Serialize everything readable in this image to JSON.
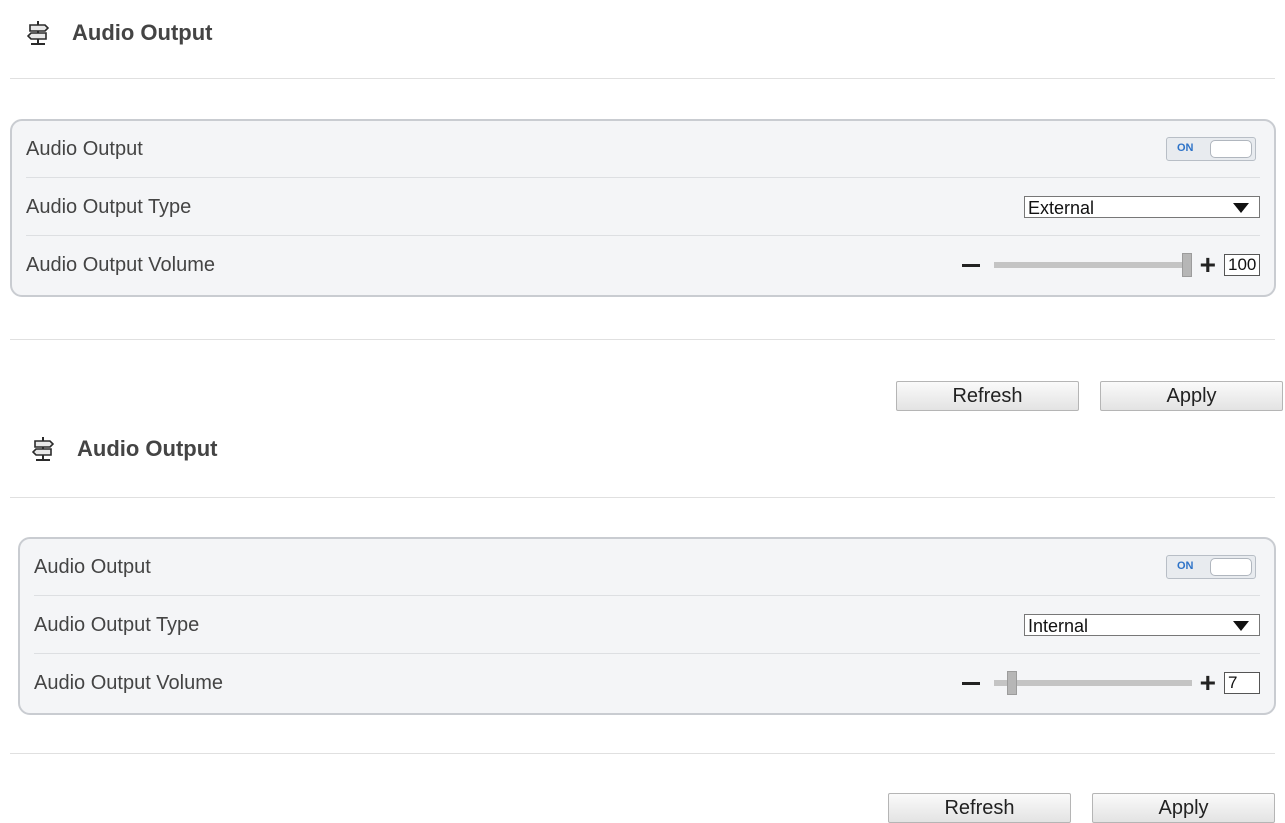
{
  "panels": [
    {
      "title": "Audio Output",
      "rows": [
        {
          "label": "Audio Output",
          "toggle_text": "ON"
        },
        {
          "label": "Audio Output Type",
          "select_value": "External"
        },
        {
          "label": "Audio Output Volume",
          "volume": "100"
        }
      ],
      "volume_fraction": 1.0,
      "buttons": {
        "refresh": "Refresh",
        "apply": "Apply"
      }
    },
    {
      "title": "Audio Output",
      "rows": [
        {
          "label": "Audio Output",
          "toggle_text": "ON"
        },
        {
          "label": "Audio Output Type",
          "select_value": "Internal"
        },
        {
          "label": "Audio Output Volume",
          "volume": "7"
        }
      ],
      "volume_fraction": 0.07,
      "buttons": {
        "refresh": "Refresh",
        "apply": "Apply"
      }
    }
  ],
  "icons": {
    "section": "signpost-icon"
  }
}
